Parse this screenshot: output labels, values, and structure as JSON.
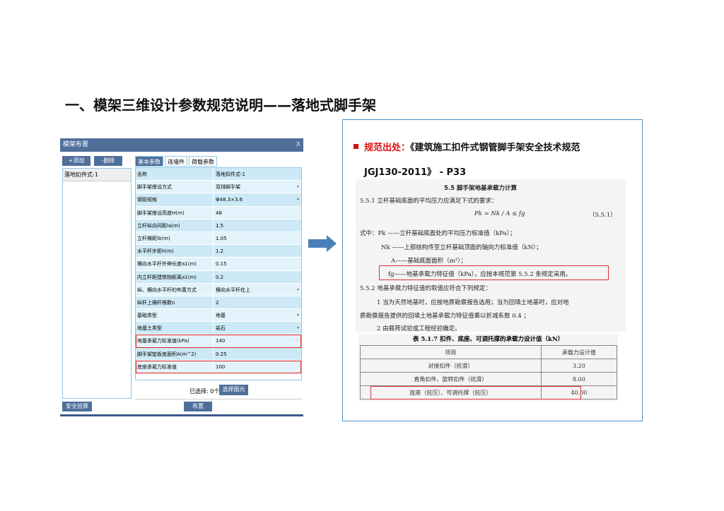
{
  "slide_title": "一、模架三维设计参数规范说明——落地式脚手架",
  "dialog": {
    "title": "模架布置",
    "close": "X",
    "add": "+添加",
    "delete": "-删除",
    "list": [
      "落地扣件式-1"
    ],
    "tabs": [
      "基本参数",
      "连墙件",
      "荷载参数"
    ],
    "rows": [
      {
        "k": "名称",
        "v": "落地扣件式-1"
      },
      {
        "k": "脚手架搭设方式",
        "v": "双排脚手架",
        "dd": "▾"
      },
      {
        "k": "钢管规格",
        "v": "Φ48.3×3.6",
        "dd": "▾"
      },
      {
        "k": "脚手架搭设高度H(m)",
        "v": "48"
      },
      {
        "k": "立杆纵向间距la(m)",
        "v": "1.5"
      },
      {
        "k": "立杆横距lb(m)",
        "v": "1.05"
      },
      {
        "k": "水平杆步距h(m)",
        "v": "1.2"
      },
      {
        "k": "横向水平杆外伸长度a1(m)",
        "v": "0.15"
      },
      {
        "k": "内立杆距建筑物距离a1(m)",
        "v": "0.2"
      },
      {
        "k": "纵、横向水平杆的布置方式",
        "v": "横向水平杆在上",
        "dd": "▾"
      },
      {
        "k": "纵杆上横杆根数n",
        "v": "2"
      },
      {
        "k": "基础类型",
        "v": "地基",
        "dd": "▾"
      },
      {
        "k": "地基土类型",
        "v": "岩石",
        "dd": "▾"
      },
      {
        "k": "地基承载力标准值(kPa)",
        "v": "140",
        "dd": "···"
      },
      {
        "k": "脚手架垫板底面积A(m^2)",
        "v": "0.25"
      },
      {
        "k": "底座承载力标准值",
        "v": "100"
      }
    ],
    "selected": "已选择: 0个",
    "select_btn": "选择图元",
    "check": "安全验算",
    "place": "布置"
  },
  "source": {
    "label": "规范出处：",
    "text": "《建筑施工扣件式钢管脚手架安全技术规范JGJ130-2011》 - P33"
  },
  "doc": {
    "heading": "5.5   脚手架地基承载力计算",
    "l1": "5.5.1  立杆基础底面的平均压力应满足下式的要求：",
    "formula": "Pk = Nk / A  ≤ fg",
    "eqno": "（5.5.1）",
    "l2": "式中：Pk ——立杆基础底面处的平均压力标准值（kPa）；",
    "l3": "Nk ——上部结构传至立杆基础顶面的轴向力标准值（kN）；",
    "l4": "A——基础底面面积（m²）；",
    "l5": "fg——地基承载力特征值（kPa），应按本规范第 5.5.2 条规定采用。",
    "l6": "5.5.2  地基承载力特征值的取值应符合下列规定：",
    "l7": "1  当为天然地基时，应按地质勘察报告选用；当为回填土地基时，应对地",
    "l8": "质勘察报告提供的回填土地基承载力特征值乘以折减系数 0.4 ；",
    "l9": "2  由载荷试验或工程经验确定。"
  },
  "table": {
    "caption": "表 5.1.7   扣件、底座、可调托撑的承载力设计值（kN）",
    "headers": [
      "项目",
      "承载力设计值"
    ],
    "rows": [
      [
        "对接扣件（抗滑）",
        "3.20"
      ],
      [
        "直角扣件、旋转扣件（抗滑）",
        "8.00"
      ],
      [
        "底座（抗压）、可调托撑（抗压）",
        "40.00"
      ]
    ]
  }
}
